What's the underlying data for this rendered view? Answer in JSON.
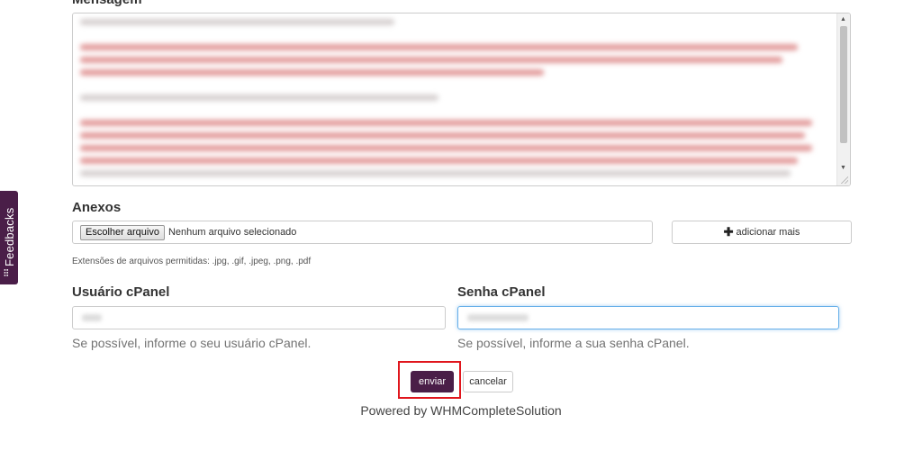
{
  "form": {
    "message_label": "Mensagem",
    "attachments_label": "Anexos",
    "file_button_label": "Escolher arquivo",
    "file_status": "Nenhum arquivo selecionado",
    "add_more_label": "adicionar mais",
    "extensions_text": "Extensões de arquivos permitidas: .jpg, .gif, .jpeg, .png, .pdf",
    "cpanel_user_label": "Usuário cPanel",
    "cpanel_user_help": "Se possível, informe o seu usuário cPanel.",
    "cpanel_password_label": "Senha cPanel",
    "cpanel_password_help": "Se possível, informe a sua senha cPanel.",
    "submit_label": "enviar",
    "cancel_label": "cancelar"
  },
  "footer": {
    "powered_by": "Powered by WHMCompleteSolution"
  },
  "feedback_tab": {
    "label": "Feedbacks"
  },
  "icons": {
    "add": "plus-icon",
    "feedback": "sliders-icon"
  },
  "colors": {
    "brand_purple": "#4a1e48",
    "highlight_red": "#e0161d",
    "focus_blue": "#66afe9"
  }
}
